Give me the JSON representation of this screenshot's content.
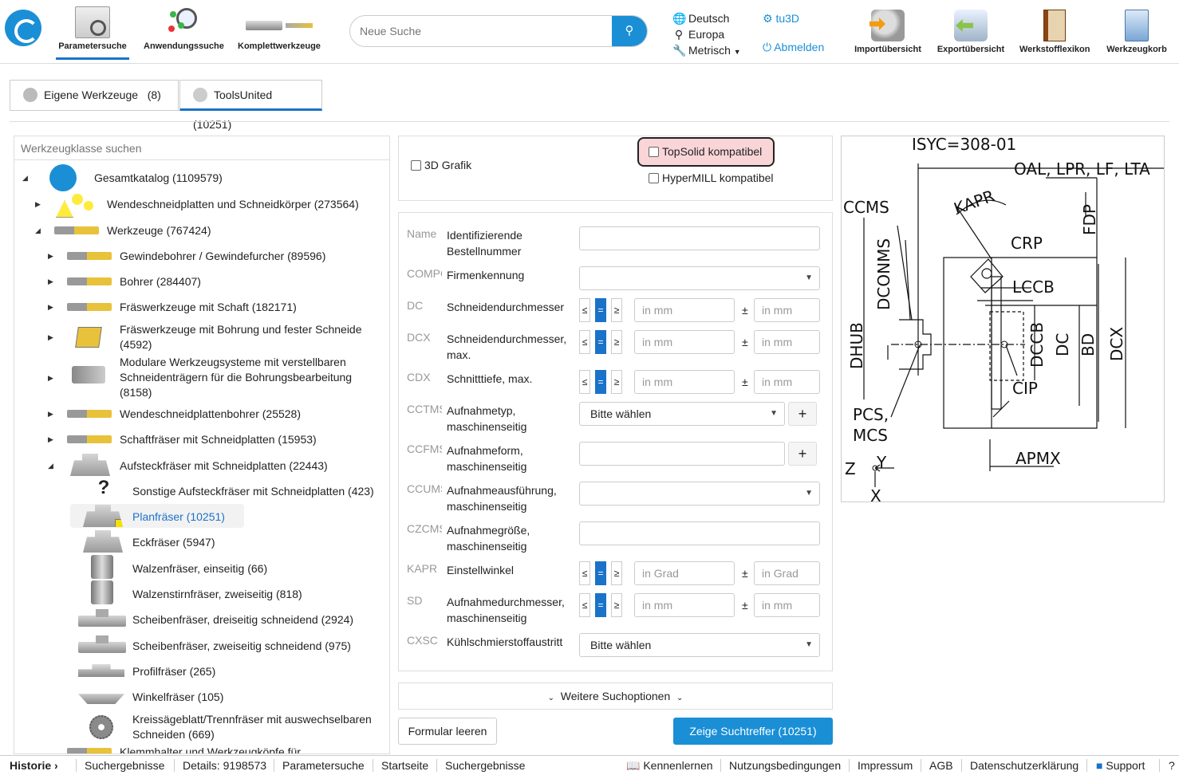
{
  "header": {
    "nav": [
      {
        "label": "Parametersuche",
        "active": true
      },
      {
        "label": "Anwendungssuche",
        "active": false
      },
      {
        "label": "Komplettwerkzeuge",
        "active": false
      }
    ],
    "search_placeholder": "Neue Suche",
    "search_icon": "magnifier-icon",
    "locale": {
      "language": "Deutsch",
      "region": "Europa",
      "units": "Metrisch"
    },
    "user": {
      "name": "tu3D",
      "logout": "Abmelden"
    },
    "tools": [
      "Importübersicht",
      "Exportübersicht",
      "Werkstofflexikon",
      "Werkzeugkorb"
    ],
    "accent_color": "#1a8fd6"
  },
  "tabs": [
    {
      "label": "Eigene Werkzeuge",
      "count": "(8)",
      "active": false
    },
    {
      "label": "ToolsUnited",
      "count": "(10251)",
      "active": true
    }
  ],
  "tree": {
    "search_placeholder": "Werkzeugklasse suchen",
    "items": [
      {
        "label": "Gesamtkatalog (1109579)"
      },
      {
        "label": "Wendeschneidplatten und Schneidkörper (273564)"
      },
      {
        "label": "Werkzeuge (767424)"
      },
      {
        "label": "Gewindebohrer / Gewindefurcher (89596)"
      },
      {
        "label": "Bohrer (284407)"
      },
      {
        "label": "Fräswerkzeuge mit Schaft (182171)"
      },
      {
        "label": "Fräswerkzeuge mit Bohrung und fester Schneide",
        "label2": "(4592)"
      },
      {
        "label": "Modulare Werkzeugsysteme mit verstellbaren",
        "label2": "Schneidenträgern für die Bohrungsbearbeitung",
        "label3": "(8158)"
      },
      {
        "label": "Wendeschneidplattenbohrer (25528)"
      },
      {
        "label": "Schaftfräser mit Schneidplatten (15953)"
      },
      {
        "label": "Aufsteckfräser mit Schneidplatten (22443)"
      },
      {
        "label": "Sonstige Aufsteckfräser mit Schneidplatten (423)"
      },
      {
        "label": "Planfräser (10251)",
        "selected": true
      },
      {
        "label": "Eckfräser (5947)"
      },
      {
        "label": "Walzenfräser, einseitig (66)"
      },
      {
        "label": "Walzenstirnfräser, zweiseitig (818)"
      },
      {
        "label": "Scheibenfräser, dreiseitig schneidend (2924)"
      },
      {
        "label": "Scheibenfräser, zweiseitig schneidend (975)"
      },
      {
        "label": "Profilfräser (265)"
      },
      {
        "label": "Winkelfräser (105)"
      },
      {
        "label": "Kreissägeblatt/Trennfräser mit auswechselbaren",
        "label2": "Schneiden (669)"
      },
      {
        "label": "Klemmhalter und Werkzeugköpfe für"
      }
    ]
  },
  "options": {
    "grafik_3d": "3D Grafik",
    "topsolid": "TopSolid kompatibel",
    "hypermill": "HyperMILL kompatibel"
  },
  "form": {
    "rows": [
      {
        "code": "Name",
        "desc": "Identifizierende Bestellnummer"
      },
      {
        "code": "COMPC",
        "desc": "Firmenkennung"
      },
      {
        "code": "DC",
        "desc": "Schneidendurchmesser",
        "ph1": "in mm",
        "ph2": "in mm"
      },
      {
        "code": "DCX",
        "desc": "Schneidendurchmesser, max.",
        "ph1": "in mm",
        "ph2": "in mm"
      },
      {
        "code": "CDX",
        "desc": "Schnitttiefe, max.",
        "ph1": "in mm",
        "ph2": "in mm"
      },
      {
        "code": "CCTMS",
        "desc": "Aufnahmetyp, maschinenseitig",
        "select": "Bitte wählen"
      },
      {
        "code": "CCFMS",
        "desc": "Aufnahmeform, maschinenseitig"
      },
      {
        "code": "CCUMS",
        "desc": "Aufnahmeausführung, maschinenseitig"
      },
      {
        "code": "CZCMS",
        "desc": "Aufnahmegröße, maschinenseitig"
      },
      {
        "code": "KAPR",
        "desc": "Einstellwinkel",
        "ph1": "in Grad",
        "ph2": "in Grad"
      },
      {
        "code": "SD",
        "desc": "Aufnahmedurchmesser, maschinenseitig",
        "ph1": "in mm",
        "ph2": "in mm"
      },
      {
        "code": "CXSC",
        "desc": "Kühlschmierstoffaustritt",
        "select": "Bitte wählen"
      }
    ],
    "cmp_le": "≤",
    "cmp_eq": "=",
    "cmp_ge": "≥",
    "pm": "±",
    "plus": "+",
    "more_options": "Weitere Suchoptionen",
    "clear": "Formular leeren",
    "show": "Zeige Suchtreffer (10251)"
  },
  "drawing": {
    "title": "ISYC=308-01",
    "labels": [
      "OAL, LPR, LF, LTA",
      "CCMS",
      "KAPR",
      "FDP",
      "CRP",
      "DCONMS",
      "LCCB",
      "DHUB",
      "DCCB",
      "DC",
      "BD",
      "DCX",
      "CIP",
      "PCS,",
      "MCS",
      "APMX",
      "Z",
      "Y",
      "X"
    ]
  },
  "footer": {
    "historie": "Historie",
    "crumbs": [
      "Suchergebnisse",
      "Details: 9198573",
      "Parametersuche",
      "Startseite",
      "Suchergebnisse"
    ],
    "links": [
      "Kennenlernen",
      "Nutzungsbedingungen",
      "Impressum",
      "AGB",
      "Datenschutzerklärung",
      "Support",
      "?"
    ]
  }
}
